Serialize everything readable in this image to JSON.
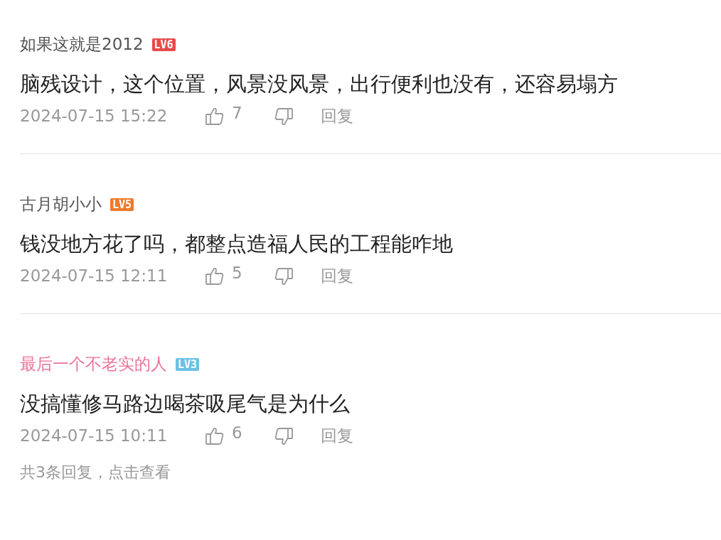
{
  "comments": [
    {
      "username": {
        "text": "如果这就是2012",
        "color": "#555555"
      },
      "level_badge": {
        "label": "LV6",
        "color": "#e84b4b"
      },
      "text": "脑残设计，这个位置，风景没风景，出行便利也没有，还容易塌方",
      "time": "2024-07-15 15:22",
      "likes": "7",
      "reply_label": "回复"
    },
    {
      "username": {
        "text": "古月胡小小",
        "color": "#555555"
      },
      "level_badge": {
        "label": "LV5",
        "color": "#ef7a2b"
      },
      "text": "钱没地方花了吗，都整点造福人民的工程能咋地",
      "time": "2024-07-15 12:11",
      "likes": "5",
      "reply_label": "回复"
    },
    {
      "username": {
        "text": "最后一个不老实的人",
        "color": "#ec7299"
      },
      "level_badge": {
        "label": "LV3",
        "color": "#6cc1e6"
      },
      "text": "没搞懂修马路边喝茶吸尾气是为什么",
      "time": "2024-07-15 10:11",
      "likes": "6",
      "reply_label": "回复",
      "replies_link": "共3条回复，点击查看"
    }
  ]
}
